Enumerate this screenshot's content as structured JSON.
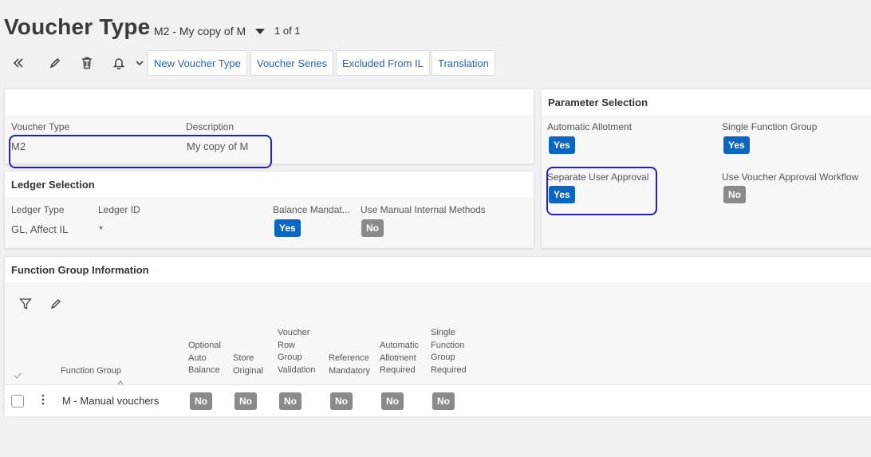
{
  "header": {
    "title": "Voucher Type",
    "record_selector": "M2 - My copy of M",
    "paging": "1 of 1"
  },
  "toolbar": {
    "icons": [
      "double-chevron-left-icon",
      "pencil-icon",
      "trash-icon",
      "bell-icon",
      "chevron-down-icon"
    ],
    "buttons": {
      "new_voucher_type": "New Voucher Type",
      "voucher_series": "Voucher Series",
      "excluded_from_il": "Excluded From IL",
      "translation": "Translation"
    }
  },
  "voucher_card": {
    "voucher_type_label": "Voucher Type",
    "voucher_type_value": "M2",
    "description_label": "Description",
    "description_value": "My copy of M"
  },
  "ledger_selection": {
    "title": "Ledger Selection",
    "ledger_type_label": "Ledger Type",
    "ledger_type_value": "GL, Affect IL",
    "ledger_id_label": "Ledger ID",
    "ledger_id_value": "*",
    "balance_mandatory_label": "Balance Mandat...",
    "balance_mandatory_value": "Yes",
    "use_manual_internal_label": "Use Manual Internal Methods",
    "use_manual_internal_value": "No"
  },
  "parameter_selection": {
    "title": "Parameter Selection",
    "automatic_allotment_label": "Automatic Allotment",
    "automatic_allotment_value": "Yes",
    "single_function_group_label": "Single Function Group",
    "single_function_group_value": "Yes",
    "separate_user_approval_label": "Separate User Approval",
    "separate_user_approval_value": "Yes",
    "use_voucher_approval_label": "Use Voucher Approval Workflow",
    "use_voucher_approval_value": "No"
  },
  "function_group": {
    "title": "Function Group Information",
    "columns": {
      "function_group": "Function Group",
      "optional_auto_balance": "Optional\nAuto\nBalance",
      "store_original": "Store\nOriginal",
      "voucher_row_group_validation": "Voucher\nRow\nGroup\nValidation",
      "reference_mandatory": "Reference\nMandatory",
      "automatic_allotment_required": "Automatic\nAllotment\nRequired",
      "single_function_group_required": "Single\nFunction\nGroup\nRequired"
    },
    "rows": [
      {
        "function_group": "M - Manual vouchers",
        "optional_auto_balance": "No",
        "store_original": "No",
        "voucher_row_group_validation": "No",
        "reference_mandatory": "No",
        "automatic_allotment_required": "No",
        "single_function_group_required": "No"
      }
    ]
  },
  "colors": {
    "accent": "#1f66b3",
    "yes_toggle": "#0b66c2",
    "no_toggle": "#8a8a8a",
    "highlight": "#2020c8"
  }
}
